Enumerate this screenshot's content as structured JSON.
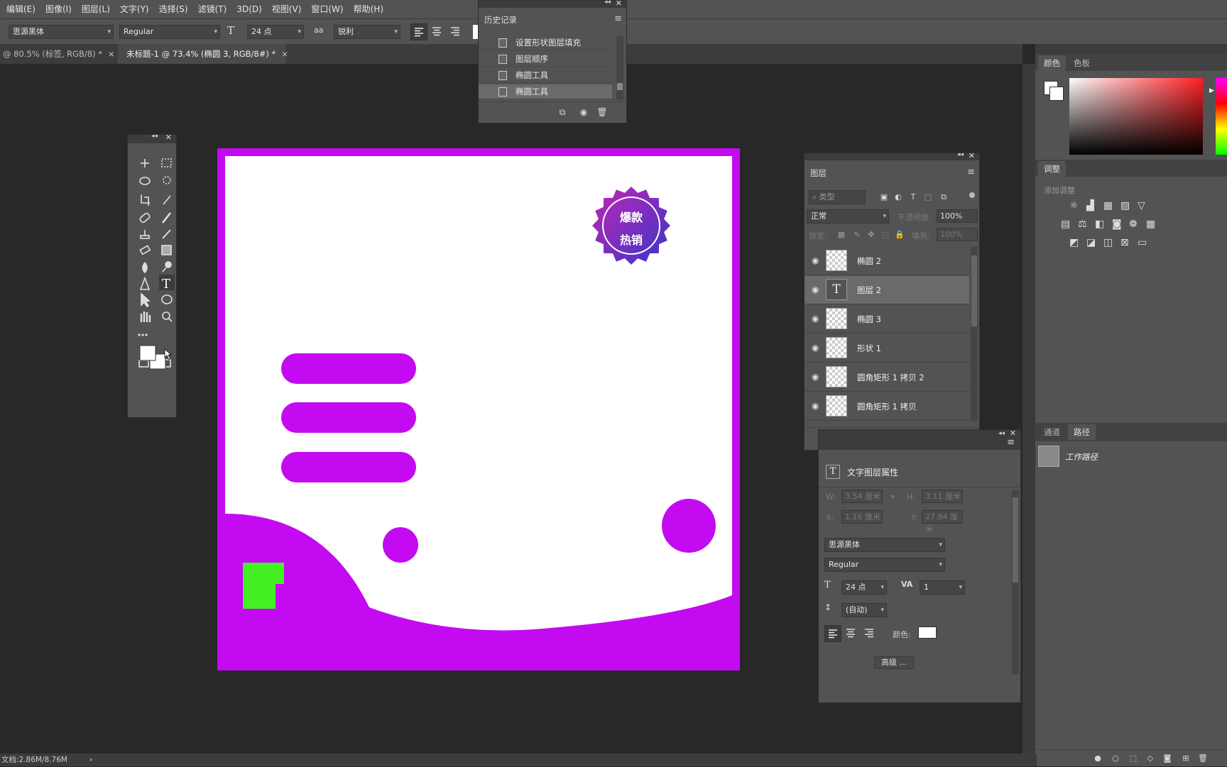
{
  "menu": [
    "编辑(E)",
    "图像(I)",
    "图层(L)",
    "文字(Y)",
    "选择(S)",
    "滤镜(T)",
    "3D(D)",
    "视图(V)",
    "窗口(W)",
    "帮助(H)"
  ],
  "options": {
    "font_family": "思源黑体",
    "font_style": "Regular",
    "font_size": "24 点",
    "aa_icon": "aa",
    "antialias": "锐利"
  },
  "tabs": [
    {
      "label": "@ 80.5% (标签, RGB/8) *",
      "close": "×"
    },
    {
      "label": "未标题-1 @ 73.4% (椭圆 3, RGB/8#) *",
      "close": "×"
    }
  ],
  "history": {
    "title": "历史记录",
    "items": [
      "设置形状图层填充",
      "图层顺序",
      "椭圆工具",
      "椭圆工具"
    ],
    "current_index": 3
  },
  "artwork": {
    "badge_line1": "爆款",
    "badge_line2": "热销"
  },
  "colors": {
    "magenta": "#c40af0",
    "green": "#43f023",
    "badge_from": "#c026b8",
    "badge_to": "#3a36c4"
  },
  "layers": {
    "title": "图层",
    "search_placeholder": "类型",
    "blend_mode": "正常",
    "opacity_label": "不透明度:",
    "opacity": "100%",
    "lock_label": "锁定:",
    "fill_label": "填充:",
    "fill": "100%",
    "items": [
      {
        "name": "椭圆 2",
        "kind": "shape"
      },
      {
        "name": "图层 2",
        "kind": "text",
        "selected": true
      },
      {
        "name": "椭圆 3",
        "kind": "shape"
      },
      {
        "name": "形状 1",
        "kind": "shape"
      },
      {
        "name": "圆角矩形 1 拷贝 2",
        "kind": "shape"
      },
      {
        "name": "圆角矩形 1 拷贝",
        "kind": "shape"
      }
    ]
  },
  "properties": {
    "title": "文字图层属性",
    "w_label": "W:",
    "w": "3.54 厘米",
    "h_label": "H:",
    "h": "3.11 厘米",
    "x_label": "X:",
    "x": "1.16 厘米",
    "y_label": "Y:",
    "y": "27.94 厘米",
    "font_family": "思源黑体",
    "font_style": "Regular",
    "font_size": "24 点",
    "tracking": "1",
    "leading": "(自动)",
    "color_label": "颜色:",
    "advanced": "高级 ..."
  },
  "right": {
    "color_tab": "颜色",
    "swatches_tab": "色板",
    "adjust_tab": "调整",
    "adjust_add": "添加调整",
    "channels_tab": "通道",
    "paths_tab": "路径",
    "work_path": "工作路径"
  },
  "status": {
    "doc": "文档:2.86M/8.76M",
    "arrow": "›"
  }
}
